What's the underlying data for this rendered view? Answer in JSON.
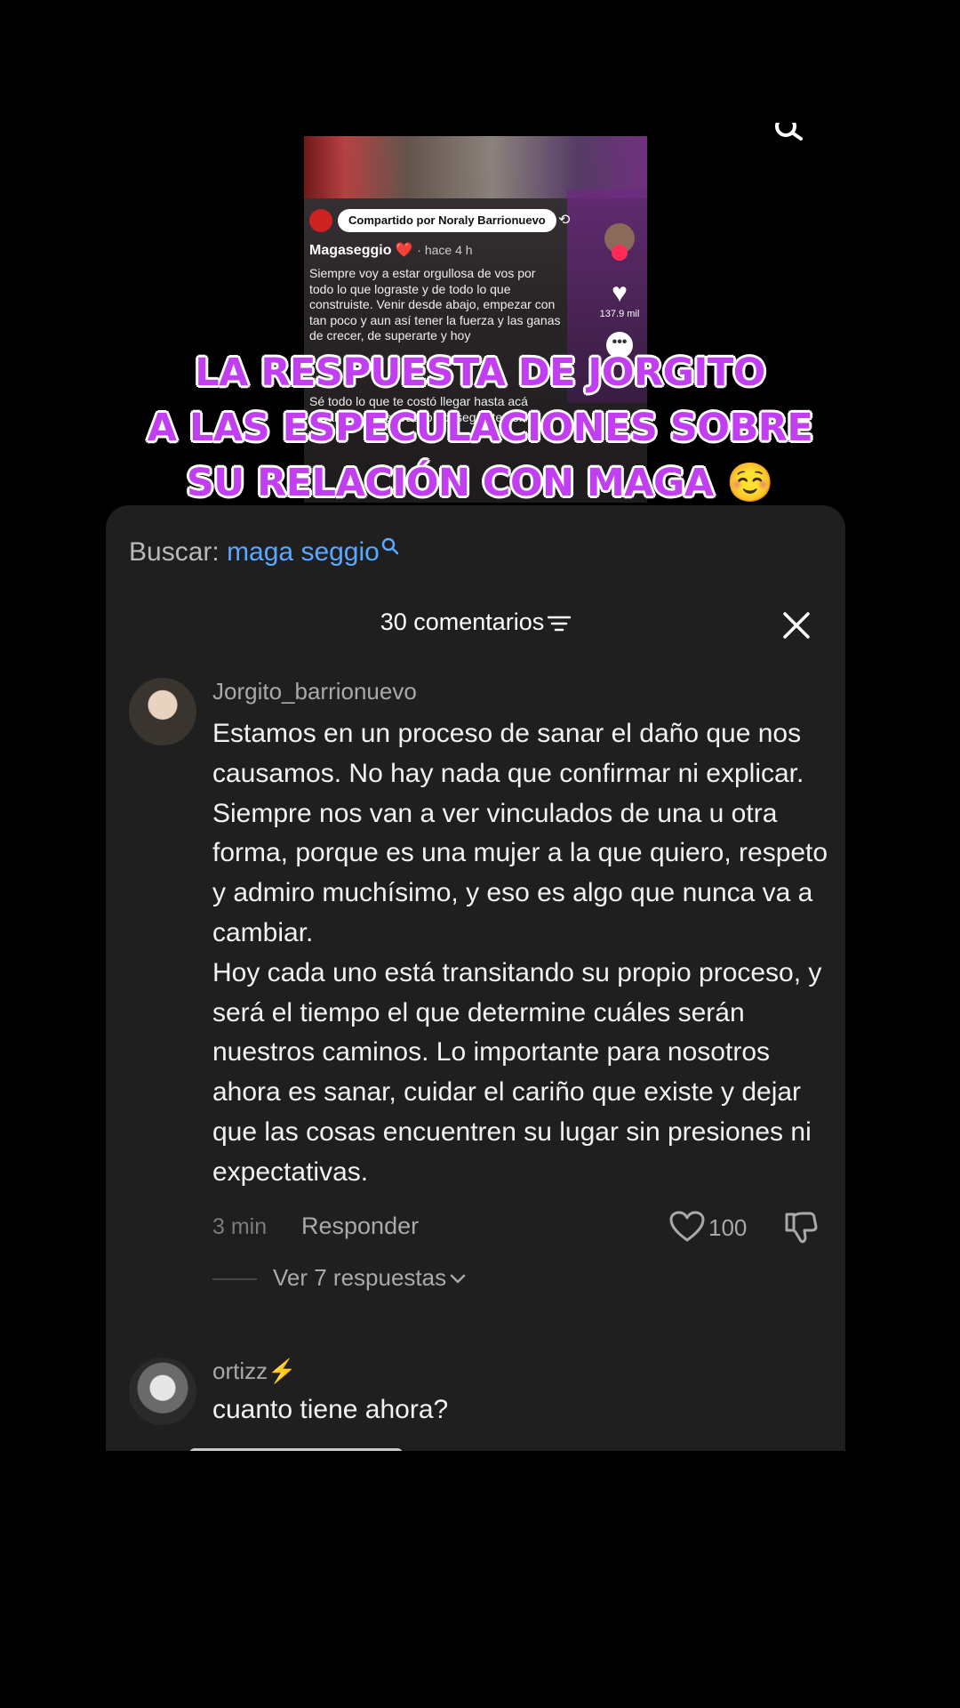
{
  "video": {
    "shared_by": "Compartido por Noraly Barrionuevo",
    "author": "Magaseggio ❤️",
    "ago": "· hace 4 h",
    "caption": "Siempre voy a estar orgullosa de vos por todo lo que lograste y de todo lo que construiste. Venir desde abajo, empezar con tan poco y aun así tener la fuerza y las ganas de crecer, de superarte y hoy",
    "caption2": "Sé todo lo que te costó llegar hasta acá regalado y que todo lo conseguiste con",
    "like_count": "137.9 mil",
    "more_glyph": "•••"
  },
  "headline": {
    "line1": "LA RESPUESTA DE JORGITO",
    "line2": "A LAS ESPECULACIONES SOBRE",
    "line3": "SU RELACIÓN CON MAGA",
    "emoji": "☺️"
  },
  "search": {
    "label": "Buscar:",
    "term": "maga seggio"
  },
  "comments_header": {
    "count_label": "30 comentarios"
  },
  "comments": [
    {
      "username": "Jorgito_barrionuevo",
      "text": "Estamos en un proceso de sanar el daño que nos causamos. No hay nada que confirmar ni explicar. Siempre nos van a ver vinculados de una u otra forma, porque es una mujer a la que quiero, respeto y admiro muchísimo, y eso es algo que nunca va a cambiar.\nHoy cada uno está transitando su propio proceso, y será el tiempo el que determine cuáles serán nuestros caminos. Lo importante para nosotros ahora es sanar, cuidar el cariño que existe y dejar que las cosas encuentren su lugar sin presiones ni expectativas.",
      "time": "3 min",
      "reply_label": "Responder",
      "likes": "100",
      "view_replies": "Ver 7 respuestas"
    },
    {
      "username": "ortizz⚡",
      "text": "cuanto tiene ahora?"
    }
  ],
  "colors": {
    "panel_bg": "#1f1f1f",
    "search_term": "#5aa8ff",
    "headline_fill": "#c13ff0",
    "headline_outline": "#ffffff"
  },
  "icons": {
    "search": "search-icon",
    "filter": "filter-icon",
    "close": "close-icon",
    "like": "heart-outline-icon",
    "dislike": "thumbs-down-icon",
    "chevron": "chevron-down-icon"
  }
}
